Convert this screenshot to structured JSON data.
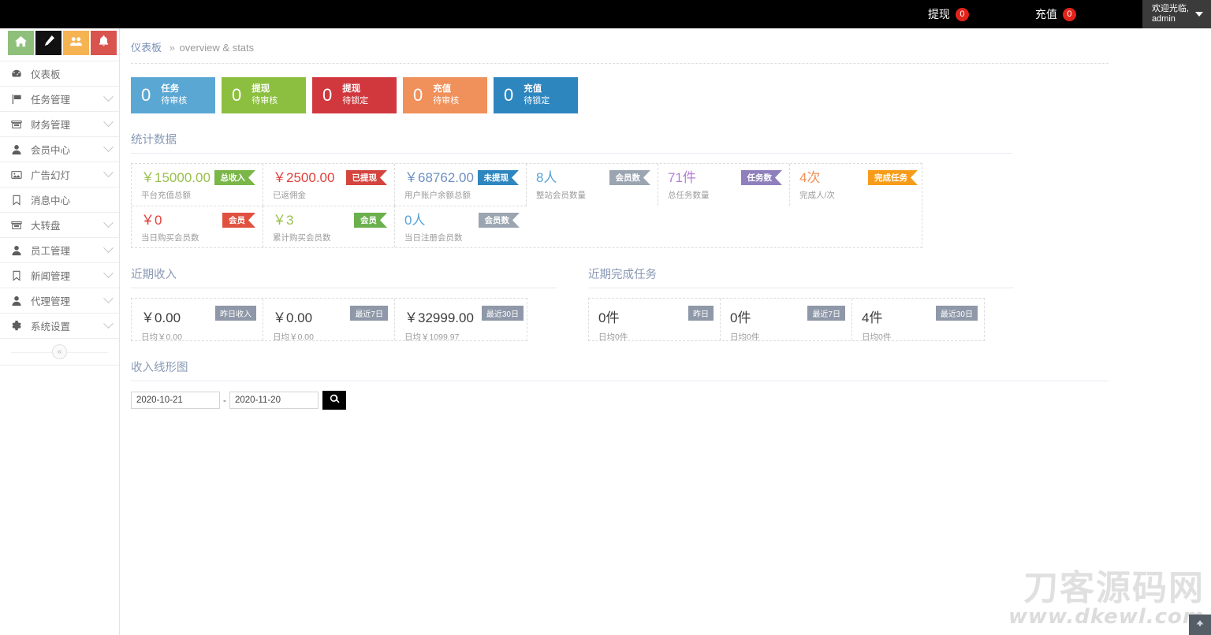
{
  "header": {
    "items": [
      {
        "label": "提现",
        "badge": "0",
        "name": "withdraw"
      },
      {
        "label": "充值",
        "badge": "0",
        "name": "recharge"
      }
    ],
    "user": {
      "greeting": "欢迎光临,",
      "name": "admin"
    },
    "badge_color": "#e2231a",
    "background": "#000000"
  },
  "sidebar": {
    "quick_actions": [
      {
        "icon": "home-icon",
        "color": "#8ec07c"
      },
      {
        "icon": "pencil-icon",
        "color": "#111111"
      },
      {
        "icon": "users-icon",
        "color": "#f6b352"
      },
      {
        "icon": "bell-icon",
        "color": "#d9534f"
      }
    ],
    "items": [
      {
        "label": "仪表板",
        "icon": "dashboard-icon",
        "expandable": false
      },
      {
        "label": "任务管理",
        "icon": "flag-icon",
        "expandable": true
      },
      {
        "label": "财务管理",
        "icon": "archive-icon",
        "expandable": true
      },
      {
        "label": "会员中心",
        "icon": "user-icon",
        "expandable": true
      },
      {
        "label": "广告幻灯",
        "icon": "image-icon",
        "expandable": true
      },
      {
        "label": "消息中心",
        "icon": "bookmark-icon",
        "expandable": false
      },
      {
        "label": "大转盘",
        "icon": "archive-icon",
        "expandable": true
      },
      {
        "label": "员工管理",
        "icon": "user-icon",
        "expandable": true
      },
      {
        "label": "新闻管理",
        "icon": "bookmark-icon",
        "expandable": true
      },
      {
        "label": "代理管理",
        "icon": "user-icon",
        "expandable": true
      },
      {
        "label": "系统设置",
        "icon": "gear-icon",
        "expandable": true
      }
    ],
    "collapse_label": "«"
  },
  "breadcrumb": {
    "main": "仪表板",
    "separator": "»",
    "sub": "overview & stats"
  },
  "kpi_cards": [
    {
      "value": "0",
      "title": "任务",
      "subtitle": "待审核",
      "color": "#5ba7d4"
    },
    {
      "value": "0",
      "title": "提现",
      "subtitle": "待审核",
      "color": "#8cbf3f"
    },
    {
      "value": "0",
      "title": "提现",
      "subtitle": "待锁定",
      "color": "#d0383e"
    },
    {
      "value": "0",
      "title": "充值",
      "subtitle": "待审核",
      "color": "#f0905a"
    },
    {
      "value": "0",
      "title": "充值",
      "subtitle": "待锁定",
      "color": "#2e86bf"
    }
  ],
  "stats_section": {
    "title": "统计数据",
    "rows": [
      [
        {
          "value": "￥15000.00",
          "value_color": "#9ac04c",
          "sub": "平台充值总额",
          "ribbon": "总收入",
          "ribbon_color": "#7ab648"
        },
        {
          "value": "￥2500.00",
          "value_color": "#e1403c",
          "sub": "已返佣金",
          "ribbon": "已提现",
          "ribbon_color": "#d3453e"
        },
        {
          "value": "￥68762.00",
          "value_color": "#6f8fc4",
          "sub": "用户账户余额总额",
          "ribbon": "未提现",
          "ribbon_color": "#2e86bf"
        },
        {
          "value": "8人",
          "value_color": "#5aa3d8",
          "sub": "整站会员数量",
          "ribbon": "会员数",
          "ribbon_color": "#9aa5b1"
        },
        {
          "value": "71件",
          "value_color": "#b47fd6",
          "sub": "总任务数量",
          "ribbon": "任务数",
          "ribbon_color": "#8f7fbd"
        },
        {
          "value": "4次",
          "value_color": "#f0905a",
          "sub": "完成人/次",
          "ribbon": "完成任务",
          "ribbon_color": "#f79c1a"
        }
      ],
      [
        {
          "value": "￥0",
          "value_color": "#e1403c",
          "sub": "当日购买会员数",
          "ribbon": "会员",
          "ribbon_color": "#e0513f"
        },
        {
          "value": "￥3",
          "value_color": "#9ac04c",
          "sub": "累计购买会员数",
          "ribbon": "会员",
          "ribbon_color": "#6ab04c"
        },
        {
          "value": "0人",
          "value_color": "#5aa3d8",
          "sub": "当日注册会员数",
          "ribbon": "会员数",
          "ribbon_color": "#9aa5b1"
        }
      ]
    ]
  },
  "recent_income": {
    "title": "近期收入",
    "cells": [
      {
        "value": "￥0.00",
        "sub": "日均￥0.00",
        "tag": "昨日收入"
      },
      {
        "value": "￥0.00",
        "sub": "日均￥0.00",
        "tag": "最近7日"
      },
      {
        "value": "￥32999.00",
        "sub": "日均￥1099.97",
        "tag": "最近30日"
      }
    ]
  },
  "recent_tasks": {
    "title": "近期完成任务",
    "cells": [
      {
        "value": "0件",
        "sub": "日均0件",
        "tag": "昨日"
      },
      {
        "value": "0件",
        "sub": "日均0件",
        "tag": "最近7日"
      },
      {
        "value": "4件",
        "sub": "日均0件",
        "tag": "最近30日"
      }
    ]
  },
  "chart_section": {
    "title": "收入线形图",
    "date_from": "2020-10-21",
    "date_to": "2020-11-20",
    "separator": "-",
    "search_icon": "search-icon"
  },
  "watermark": {
    "cn": "刀客源码网",
    "en": "www.dkewl.com"
  }
}
